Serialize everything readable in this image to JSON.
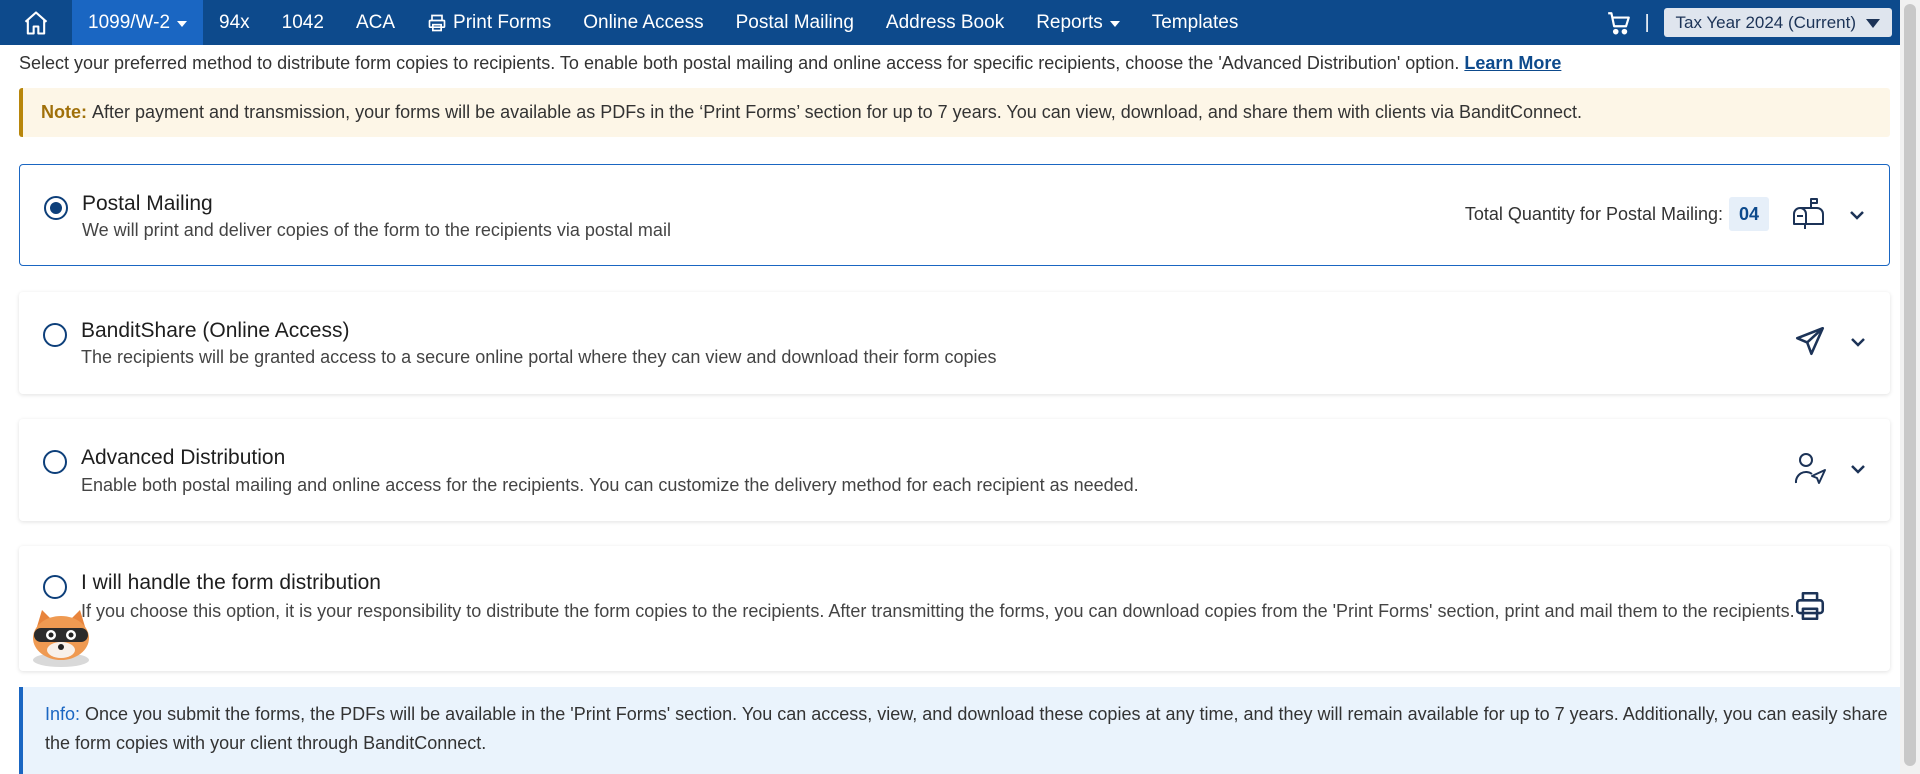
{
  "nav": {
    "items": [
      {
        "label": "1099/W-2",
        "active": true,
        "dropdown": true
      },
      {
        "label": "94x"
      },
      {
        "label": "1042"
      },
      {
        "label": "ACA"
      },
      {
        "label": "Print Forms",
        "icon": "printer-icon"
      },
      {
        "label": "Online Access"
      },
      {
        "label": "Postal Mailing"
      },
      {
        "label": "Address Book"
      },
      {
        "label": "Reports",
        "dropdown": true
      },
      {
        "label": "Templates"
      }
    ],
    "separator": "|",
    "tax_year": "Tax Year 2024 (Current)"
  },
  "intro": {
    "text": "Select your preferred method to distribute form copies to recipients. To enable both postal mailing and online access for specific recipients, choose the 'Advanced Distribution' option.",
    "link": "Learn More"
  },
  "note": {
    "label": "Note:",
    "text": "After payment and transmission, your forms will be available as PDFs in the ‘Print Forms’ section for up to 7 years. You can view, download, and share them with clients via BanditConnect."
  },
  "options": [
    {
      "title": "Postal Mailing",
      "desc": "We will print and deliver copies of the form to the recipients via postal mail",
      "selected": true,
      "qty_label": "Total Quantity for Postal Mailing:",
      "qty_value": "04",
      "icon": "mailbox-icon"
    },
    {
      "title": "BanditShare (Online Access)",
      "desc": "The recipients will be granted access to a secure online portal where they can view and download their form copies",
      "selected": false,
      "icon": "send-icon"
    },
    {
      "title": "Advanced Distribution",
      "desc": "Enable both postal mailing and online access for the recipients. You can customize the delivery method for each recipient as needed.",
      "selected": false,
      "icon": "user-send-icon"
    },
    {
      "title": "I will handle the form distribution",
      "desc": "If you choose this option, it is your responsibility to distribute the form copies to the recipients. After transmitting the forms, you can download copies from the 'Print Forms' section, print and mail them to the recipients.",
      "selected": false,
      "icon": "printer-icon"
    }
  ],
  "info": {
    "label": "Info:",
    "text": "Once you submit the forms, the PDFs will be available in the 'Print Forms' section. You can access, view, and download these copies at any time, and they will remain available for up to 7 years. Additionally, you can easily share the form copies with your client through BanditConnect."
  },
  "colors": {
    "nav_bg": "#0d4a8c",
    "nav_active": "#1a66c2",
    "note_bg": "#fdf6e7",
    "info_bg": "#eaf3fc"
  }
}
